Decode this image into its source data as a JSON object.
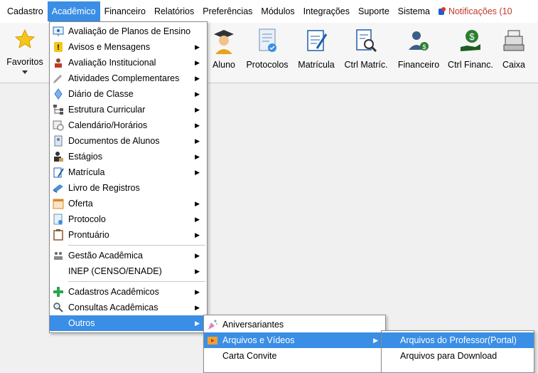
{
  "menubar": {
    "items": [
      "Cadastro",
      "Acadêmico",
      "Financeiro",
      "Relatórios",
      "Preferências",
      "Módulos",
      "Integrações",
      "Suporte",
      "Sistema"
    ],
    "notifications": "Notificações (10"
  },
  "toolbar": {
    "favoritos": "Favoritos",
    "aluno": "Aluno",
    "protocolos": "Protocolos",
    "matricula": "Matrícula",
    "ctrl_matric": "Ctrl Matríc.",
    "financeiro": "Financeiro",
    "ctrl_financ": "Ctrl Financ.",
    "caixa": "Caixa"
  },
  "academico_menu": {
    "items": [
      "Avaliação de Planos de Ensino",
      "Avisos e Mensagens",
      "Avaliação Institucional",
      "Atividades Complementares",
      "Diário de Classe",
      "Estrutura Curricular",
      "Calendário/Horários",
      "Documentos de Alunos",
      "Estágios",
      "Matrícula",
      "Livro de Registros",
      "Oferta",
      "Protocolo",
      "Prontuário",
      "Gestão Acadêmica",
      "INEP (CENSO/ENADE)",
      "Cadastros Acadêmicos",
      "Consultas Acadêmicas",
      "Outros"
    ]
  },
  "outros_menu": {
    "items": [
      "Aniversariantes",
      "Arquivos e Vídeos",
      "Carta Convite"
    ]
  },
  "arquivos_menu": {
    "items": [
      "Arquivos do Professor(Portal)",
      "Arquivos para Download"
    ]
  }
}
